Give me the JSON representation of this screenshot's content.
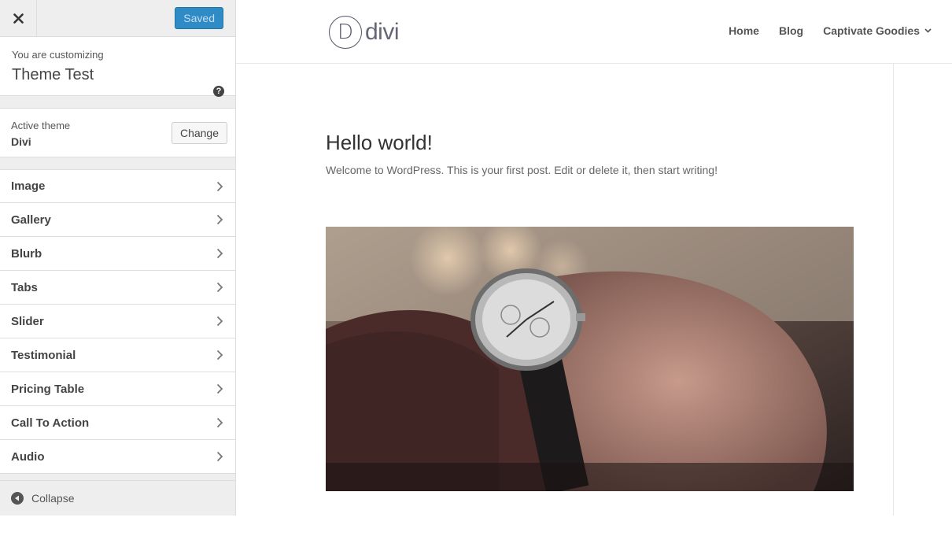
{
  "customizer": {
    "saved_label": "Saved",
    "customizing_sub": "You are customizing",
    "customizing_title": "Theme Test",
    "help_glyph": "?",
    "active_theme_label": "Active theme",
    "active_theme_name": "Divi",
    "change_label": "Change",
    "sections": [
      {
        "title": "Image"
      },
      {
        "title": "Gallery"
      },
      {
        "title": "Blurb"
      },
      {
        "title": "Tabs"
      },
      {
        "title": "Slider"
      },
      {
        "title": "Testimonial"
      },
      {
        "title": "Pricing Table"
      },
      {
        "title": "Call To Action"
      },
      {
        "title": "Audio"
      }
    ],
    "collapse_label": "Collapse"
  },
  "site": {
    "logo_letter": "D",
    "logo_text": "divi",
    "nav": [
      "Home",
      "Blog",
      "Captivate Goodies"
    ],
    "post_title": "Hello world!",
    "post_text": "Welcome to WordPress. This is your first post. Edit or delete it, then start writing!"
  },
  "colors": {
    "saved_button": "#2e8bc6",
    "sidebar_bg": "#eeeeee"
  },
  "icons": {
    "close": "close-icon",
    "help": "help-icon",
    "chevron": "chevron-right-icon",
    "collapse": "collapse-arrow-icon",
    "nav_dropdown": "chevron-down-icon"
  }
}
